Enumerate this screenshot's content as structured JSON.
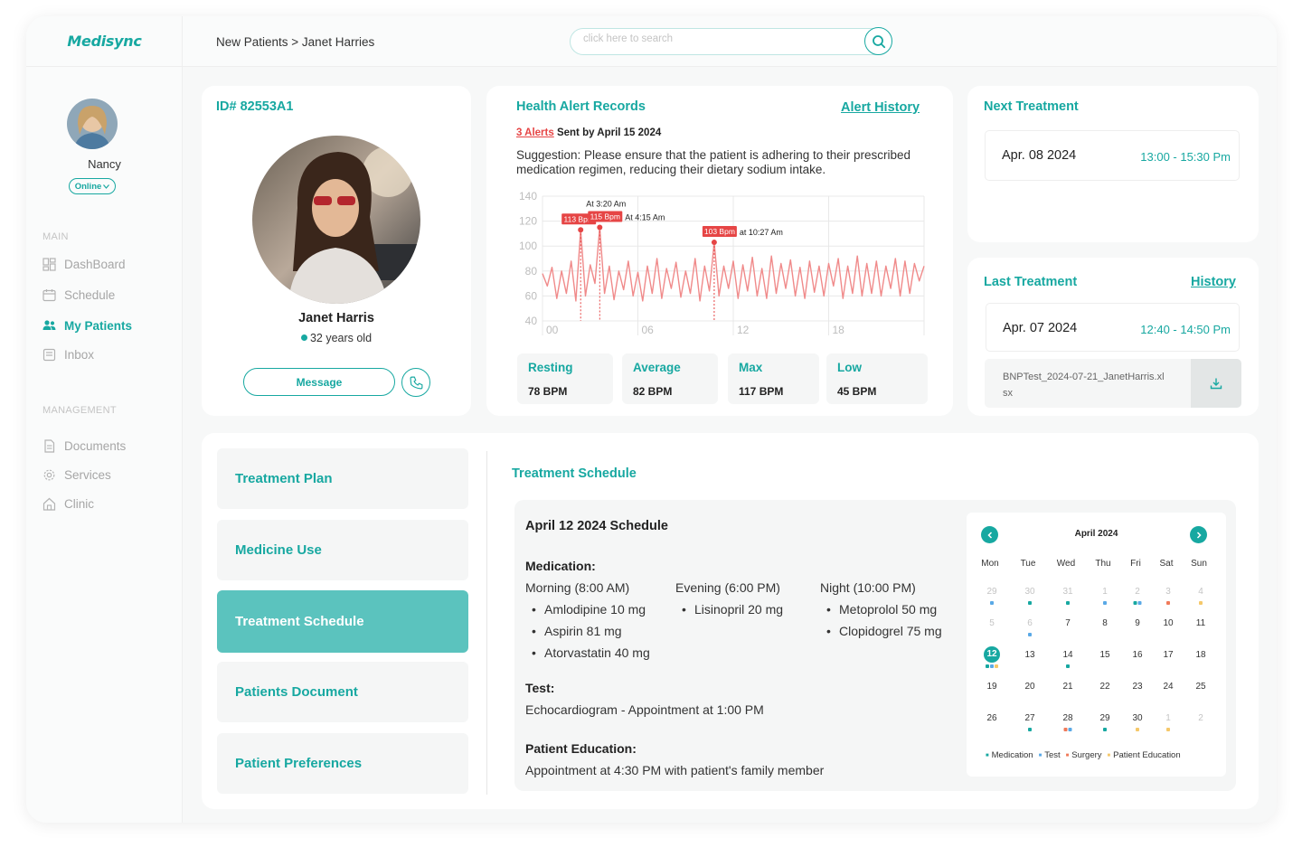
{
  "app": {
    "logo": "Medisync"
  },
  "user": {
    "name": "Nancy",
    "status": "Online"
  },
  "sidebar": {
    "main_label": "MAIN",
    "main_items": [
      {
        "label": "DashBoard",
        "icon": "dashboard-icon"
      },
      {
        "label": "Schedule",
        "icon": "calendar-icon"
      },
      {
        "label": "My Patients",
        "icon": "patients-icon",
        "active": true
      },
      {
        "label": "Inbox",
        "icon": "inbox-icon"
      }
    ],
    "management_label": "MANAGEMENT",
    "management_items": [
      {
        "label": "Documents",
        "icon": "document-icon"
      },
      {
        "label": "Services",
        "icon": "gear-icon"
      },
      {
        "label": "Clinic",
        "icon": "home-icon"
      }
    ]
  },
  "topbar": {
    "breadcrumb": "New Patients > Janet Harries",
    "search_placeholder": "click here to search"
  },
  "patient": {
    "id": "ID# 82553A1",
    "name": "Janet Harris",
    "age": "32 years old",
    "message_label": "Message"
  },
  "alerts": {
    "title": "Health Alert Records",
    "history_link": "Alert History",
    "count_text": "3 Alerts",
    "sent_text": "Sent by April 15 2024",
    "suggestion": "Suggestion: Please ensure that the patient is adhering to their prescribed medication regimen, reducing their dietary sodium intake.",
    "stats": [
      {
        "label": "Resting",
        "value": "78 BPM"
      },
      {
        "label": "Average",
        "value": "82 BPM"
      },
      {
        "label": "Max",
        "value": "117 BPM"
      },
      {
        "label": "Low",
        "value": "45 BPM"
      }
    ]
  },
  "chart_data": {
    "type": "line",
    "ylim": [
      40,
      140
    ],
    "yticks": [
      140,
      120,
      100,
      80,
      60,
      40
    ],
    "xticks": [
      "00",
      "06",
      "12",
      "18"
    ],
    "xlim": [
      0,
      24
    ],
    "series": [
      {
        "values_description": "heart rate (bpm) over 24 hours",
        "points": [
          [
            0,
            78
          ],
          [
            0.3,
            68
          ],
          [
            0.6,
            83
          ],
          [
            0.9,
            58
          ],
          [
            1.2,
            80
          ],
          [
            1.5,
            62
          ],
          [
            1.8,
            88
          ],
          [
            2.1,
            56
          ],
          [
            2.4,
            113
          ],
          [
            2.7,
            60
          ],
          [
            3.0,
            85
          ],
          [
            3.3,
            70
          ],
          [
            3.6,
            115
          ],
          [
            3.9,
            62
          ],
          [
            4.2,
            84
          ],
          [
            4.5,
            57
          ],
          [
            4.8,
            80
          ],
          [
            5.1,
            65
          ],
          [
            5.4,
            88
          ],
          [
            5.7,
            60
          ],
          [
            6.0,
            79
          ],
          [
            6.3,
            56
          ],
          [
            6.6,
            84
          ],
          [
            6.9,
            62
          ],
          [
            7.2,
            90
          ],
          [
            7.5,
            58
          ],
          [
            7.8,
            82
          ],
          [
            8.1,
            66
          ],
          [
            8.4,
            87
          ],
          [
            8.7,
            59
          ],
          [
            9.0,
            80
          ],
          [
            9.3,
            62
          ],
          [
            9.6,
            90
          ],
          [
            9.9,
            56
          ],
          [
            10.2,
            84
          ],
          [
            10.5,
            64
          ],
          [
            10.8,
            103
          ],
          [
            11.1,
            60
          ],
          [
            11.4,
            84
          ],
          [
            11.7,
            66
          ],
          [
            12.0,
            88
          ],
          [
            12.3,
            58
          ],
          [
            12.6,
            85
          ],
          [
            12.9,
            64
          ],
          [
            13.2,
            91
          ],
          [
            13.5,
            60
          ],
          [
            13.8,
            82
          ],
          [
            14.1,
            58
          ],
          [
            14.4,
            92
          ],
          [
            14.7,
            62
          ],
          [
            15.0,
            86
          ],
          [
            15.3,
            66
          ],
          [
            15.6,
            89
          ],
          [
            15.9,
            60
          ],
          [
            16.2,
            83
          ],
          [
            16.5,
            58
          ],
          [
            16.8,
            88
          ],
          [
            17.1,
            63
          ],
          [
            17.4,
            84
          ],
          [
            17.7,
            60
          ],
          [
            18.0,
            86
          ],
          [
            18.3,
            68
          ],
          [
            18.6,
            90
          ],
          [
            18.9,
            58
          ],
          [
            19.2,
            84
          ],
          [
            19.5,
            62
          ],
          [
            19.8,
            92
          ],
          [
            20.1,
            60
          ],
          [
            20.4,
            86
          ],
          [
            20.7,
            62
          ],
          [
            21.0,
            88
          ],
          [
            21.3,
            60
          ],
          [
            21.6,
            84
          ],
          [
            21.9,
            66
          ],
          [
            22.2,
            90
          ],
          [
            22.5,
            60
          ],
          [
            22.8,
            88
          ],
          [
            23.1,
            62
          ],
          [
            23.4,
            86
          ],
          [
            23.7,
            72
          ],
          [
            24.0,
            84
          ]
        ]
      }
    ],
    "annotations": [
      {
        "x": 2.4,
        "y": 113,
        "badge": "113 Bpm",
        "note": "At 3:20 Am"
      },
      {
        "x": 3.6,
        "y": 115,
        "badge": "115 Bpm",
        "note": "At 4:15 Am"
      },
      {
        "x": 10.8,
        "y": 103,
        "badge": "103 Bpm",
        "note": "at 10:27 Am"
      }
    ],
    "line_color": "#f08a8a",
    "grid": true
  },
  "next_treatment": {
    "title": "Next Treatment",
    "date": "Apr. 08 2024",
    "time": "13:00 - 15:30 Pm"
  },
  "last_treatment": {
    "title": "Last Treatment",
    "history_link": "History",
    "date": "Apr. 07 2024",
    "time": "12:40 - 14:50 Pm",
    "file": "BNPTest_2024-07-21_JanetHarris.xlsx"
  },
  "tabs": [
    {
      "label": "Treatment Plan"
    },
    {
      "label": "Medicine Use"
    },
    {
      "label": "Treatment Schedule",
      "active": true
    },
    {
      "label": "Patients Document"
    },
    {
      "label": "Patient Preferences"
    }
  ],
  "schedule": {
    "title": "Treatment Schedule",
    "day_title": "April 12 2024 Schedule",
    "medication_label": "Medication:",
    "columns": [
      {
        "header": "Morning (8:00 AM)",
        "items": [
          "Amlodipine 10 mg",
          "Aspirin 81 mg",
          "Atorvastatin 40 mg"
        ]
      },
      {
        "header": "Evening (6:00 PM)",
        "items": [
          "Lisinopril 20 mg"
        ]
      },
      {
        "header": "Night (10:00 PM)",
        "items": [
          "Metoprolol 50 mg",
          "Clopidogrel 75 mg"
        ]
      }
    ],
    "test_label": "Test:",
    "test_text": "Echocardiogram - Appointment at 1:00 PM",
    "education_label": "Patient Education:",
    "education_text": "Appointment at 4:30 PM with patient's family member"
  },
  "calendar": {
    "title": "April 2024",
    "weekdays": [
      "Mon",
      "Tue",
      "Wed",
      "Thu",
      "Fri",
      "Sat",
      "Sun"
    ],
    "weeks": [
      [
        "29",
        "30",
        "31",
        "1",
        "2",
        "3",
        "4"
      ],
      [
        "5",
        "6",
        "7",
        "8",
        "9",
        "10",
        "11"
      ],
      [
        "12",
        "13",
        "14",
        "15",
        "16",
        "17",
        "18"
      ],
      [
        "19",
        "20",
        "21",
        "22",
        "23",
        "24",
        "25"
      ],
      [
        "26",
        "27",
        "28",
        "29",
        "30",
        "1",
        "2"
      ]
    ],
    "muted": [
      [
        0,
        0
      ],
      [
        0,
        1
      ],
      [
        0,
        2
      ],
      [
        0,
        3
      ],
      [
        0,
        4
      ],
      [
        0,
        5
      ],
      [
        0,
        6
      ],
      [
        1,
        0
      ],
      [
        1,
        1
      ],
      [
        4,
        5
      ],
      [
        4,
        6
      ]
    ],
    "today": [
      2,
      0
    ],
    "markers": {
      "0-0": [
        "#5aa9e6"
      ],
      "0-1": [
        "#17a8a1"
      ],
      "0-2": [
        "#17a8a1"
      ],
      "0-3": [
        "#5aa9e6"
      ],
      "0-4": [
        "#17a8a1",
        "#5aa9e6"
      ],
      "0-5": [
        "#f07a5a"
      ],
      "0-6": [
        "#f5c86a"
      ],
      "1-1": [
        "#5aa9e6"
      ],
      "2-0": [
        "#17a8a1",
        "#5aa9e6",
        "#f5c86a"
      ],
      "2-2": [
        "#17a8a1"
      ],
      "4-1": [
        "#17a8a1"
      ],
      "4-2": [
        "#f07a5a",
        "#5aa9e6"
      ],
      "4-3": [
        "#17a8a1"
      ],
      "4-4": [
        "#f5c86a"
      ],
      "4-5": [
        "#f5c86a"
      ]
    },
    "legend": [
      {
        "label": "Medication",
        "color": "#17a8a1"
      },
      {
        "label": "Test",
        "color": "#5aa9e6"
      },
      {
        "label": "Surgery",
        "color": "#f07a5a"
      },
      {
        "label": "Patient Education",
        "color": "#f5c86a"
      }
    ]
  }
}
